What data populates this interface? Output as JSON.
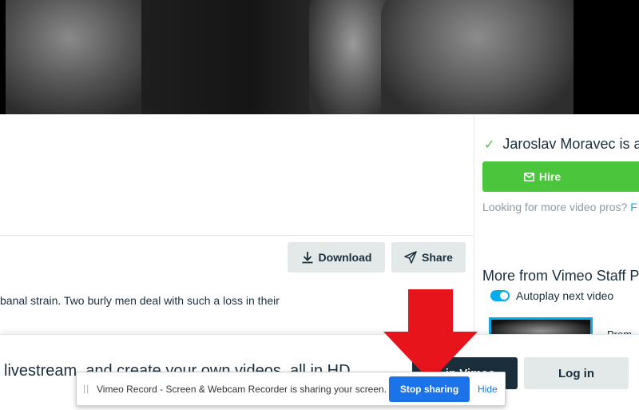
{
  "video": {},
  "actions": {
    "download_label": "Download",
    "share_label": "Share"
  },
  "description": {
    "text": "banal strain. Two burly men deal with such a loss in their"
  },
  "sidebar": {
    "availability_text": "Jaroslav Moravec is a",
    "hire_label": "Hire",
    "pros_text": "Looking for more video pros? ",
    "pros_link": "F",
    "more_from": "More from Vimeo Staff P",
    "autoplay_label": "Autoplay next video",
    "thumb_title": "Prom"
  },
  "banner": {
    "text": "livestream, and create your own videos, all in HD.",
    "join_label": "in Vimeo",
    "login_label": "Log in"
  },
  "share_bar": {
    "grip": "||",
    "message": "Vimeo Record - Screen & Webcam Recorder is sharing your screen.",
    "stop_label": "Stop sharing",
    "hide_label": "Hide"
  },
  "colors": {
    "hire_green": "#4bc63c",
    "accent_blue": "#00adef",
    "chrome_blue": "#1a73e8",
    "annotation_red": "#e8141c",
    "dark_navy": "#1a2e3b"
  }
}
